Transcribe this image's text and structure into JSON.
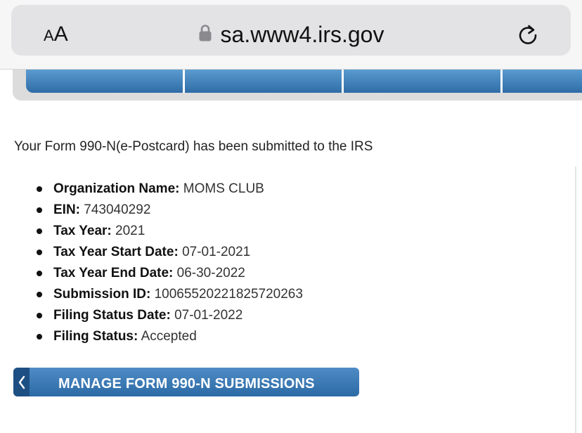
{
  "browser": {
    "text_size_label_small": "A",
    "text_size_label_large": "A",
    "url": "sa.www4.irs.gov"
  },
  "main": {
    "confirmation_message": "Your Form 990-N(e-Postcard) has been submitted to the IRS",
    "details": [
      {
        "label": "Organization Name:",
        "value": "MOMS CLUB"
      },
      {
        "label": "EIN:",
        "value": "743040292"
      },
      {
        "label": "Tax Year:",
        "value": "2021"
      },
      {
        "label": "Tax Year Start Date:",
        "value": "07-01-2021"
      },
      {
        "label": "Tax Year End Date:",
        "value": "06-30-2022"
      },
      {
        "label": "Submission ID:",
        "value": "10065520221825720263"
      },
      {
        "label": "Filing Status Date:",
        "value": "07-01-2022"
      },
      {
        "label": "Filing Status:",
        "value": "Accepted"
      }
    ],
    "manage_button_label": "MANAGE FORM 990-N SUBMISSIONS"
  },
  "icons": {
    "lock": "lock-icon",
    "reload": "reload-icon",
    "back": "chevron-left-icon"
  },
  "colors": {
    "nav_blue": "#2f6ca6",
    "button_blue": "#3c7bb8",
    "button_dark": "#1e4f83"
  }
}
